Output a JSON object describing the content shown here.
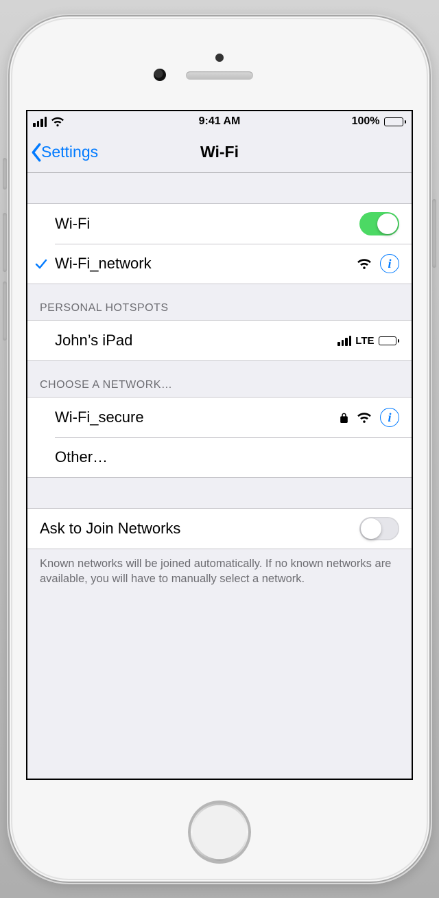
{
  "status": {
    "time": "9:41 AM",
    "battery_percent": "100%"
  },
  "nav": {
    "back_label": "Settings",
    "title": "Wi-Fi"
  },
  "wifi_toggle": {
    "label": "Wi-Fi",
    "on": true
  },
  "connected": {
    "name": "Wi-Fi_network"
  },
  "sections": {
    "hotspots_header": "Personal Hotspots",
    "hotspots": [
      {
        "name": "John’s iPad",
        "network_type": "LTE"
      }
    ],
    "networks_header": "Choose a Network…",
    "networks": [
      {
        "name": "Wi-Fi_secure",
        "secure": true
      }
    ],
    "other_label": "Other…"
  },
  "ask_join": {
    "label": "Ask to Join Networks",
    "on": false,
    "footer": "Known networks will be joined automatically. If no known networks are available, you will have to manually select a network."
  }
}
